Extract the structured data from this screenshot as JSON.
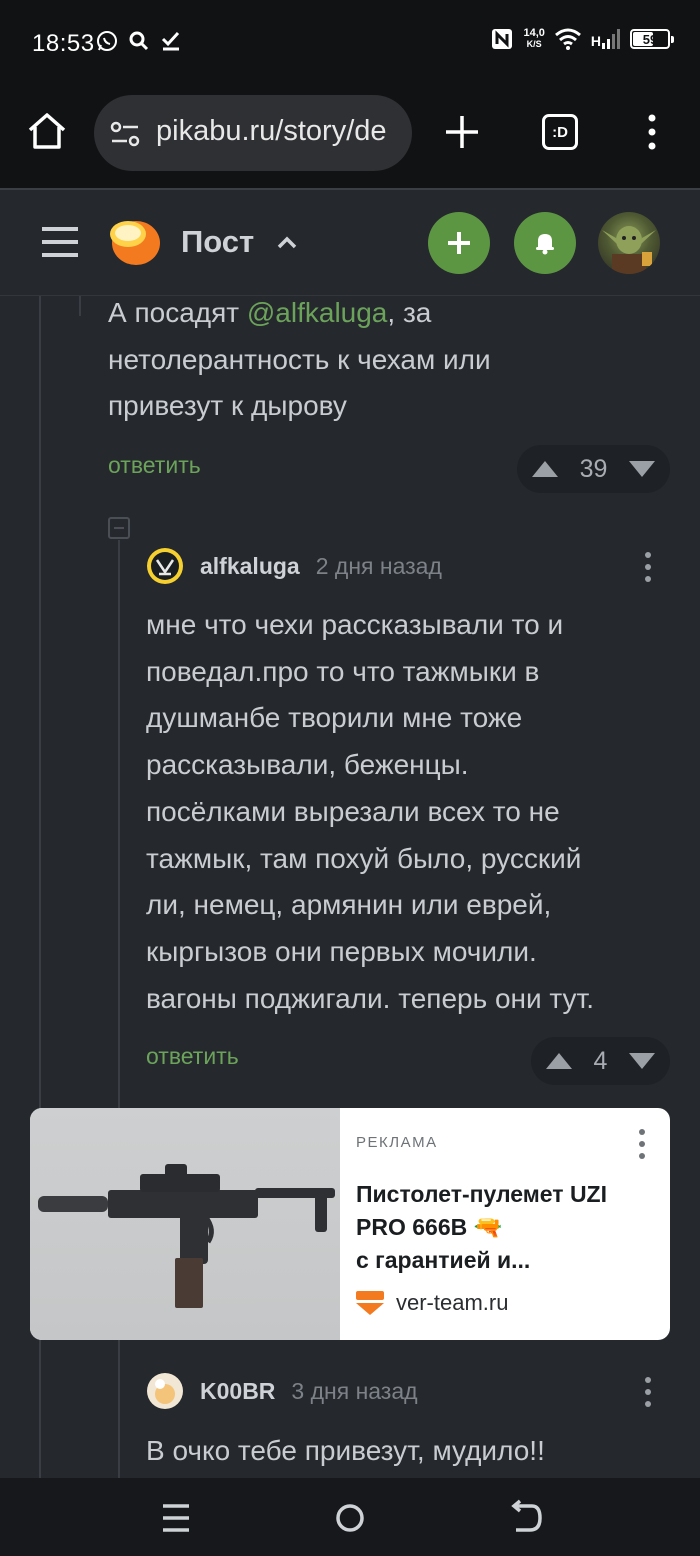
{
  "status_bar": {
    "time": "18:53",
    "net_speed_value": "14,0",
    "net_speed_unit": "K/S",
    "signal_label": "H",
    "battery": "59",
    "battery_level": 0.59,
    "icons": [
      "whatsapp-icon",
      "search-icon",
      "download-done-icon",
      "nfc-icon",
      "wifi-icon",
      "signal-icon",
      "battery-icon"
    ]
  },
  "browser": {
    "url": "pikabu.ru/story/de",
    "tabs_label": ":D",
    "icons": [
      "home-icon",
      "site-settings-icon",
      "plus-icon",
      "tabs-icon",
      "more-vert-icon"
    ]
  },
  "header": {
    "title": "Пост",
    "accent": "#5d9643",
    "icons": [
      "menu-icon",
      "pikabu-logo",
      "chevron-up-icon",
      "plus-icon",
      "bell-icon",
      "avatar"
    ]
  },
  "comments": [
    {
      "text_prefix": "А посадят ",
      "mention": "@alfkaluga",
      "text_suffix": ", за",
      "text_line2": "нетолерантность к чехам или",
      "text_line3": "привезут к дырову",
      "reply_label": "ответить",
      "votes": "39"
    },
    {
      "author": "alfkaluga",
      "time": "2 дня назад",
      "lines": [
        "мне что чехи рассказывали то и",
        "поведал.про то что тажмыки в",
        "душманбе творили мне тоже",
        "рассказывали, беженцы.",
        "посёлками вырезали всех то не",
        "тажмык, там похуй было, русский",
        "ли, немец, армянин или еврей,",
        "кыргызов они первых мочили.",
        "вагоны поджигали. теперь они тут."
      ],
      "reply_label": "ответить",
      "votes": "4"
    },
    {
      "author": "K00BR",
      "time": "3 дня назад",
      "text": "В очко тебе привезут, мудило!!"
    }
  ],
  "ad": {
    "label": "РЕКЛАМА",
    "title_line1": "Пистолет-пулемет UZI",
    "title_line2": "PRO 666B 🔫",
    "title_line3": "с гарантией и...",
    "domain": "ver-team.ru"
  },
  "nav": {
    "icons": [
      "recents-icon",
      "home-circle-icon",
      "back-icon"
    ]
  }
}
